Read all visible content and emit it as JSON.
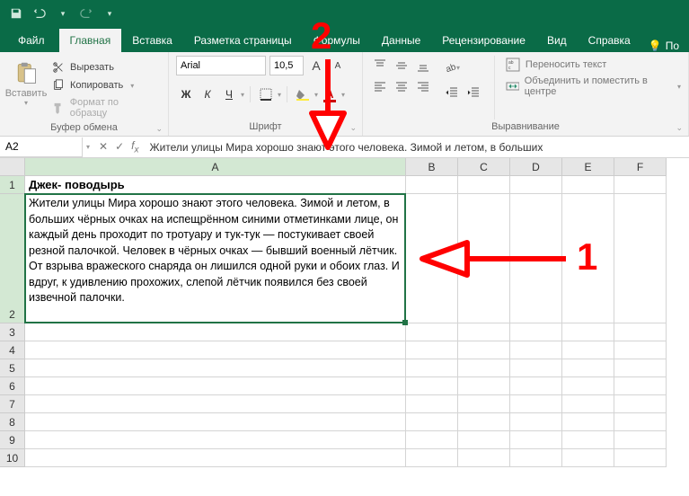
{
  "qat": {
    "save": "save-icon",
    "undo": "undo-icon",
    "redo": "redo-icon"
  },
  "tabs": {
    "file": "Файл",
    "list": [
      "Главная",
      "Вставка",
      "Разметка страницы",
      "Формулы",
      "Данные",
      "Рецензирование",
      "Вид",
      "Справка"
    ],
    "activeIndex": 0,
    "help_hint": "По"
  },
  "ribbon": {
    "clipboard": {
      "paste": "Вставить",
      "cut": "Вырезать",
      "copy": "Копировать",
      "format_painter": "Формат по образцу",
      "group_label": "Буфер обмена"
    },
    "font": {
      "name": "Arial",
      "size": "10,5",
      "grow": "A",
      "shrink": "A",
      "bold": "Ж",
      "italic": "К",
      "underline": "Ч",
      "group_label": "Шрифт"
    },
    "alignment": {
      "wrap": "Переносить текст",
      "merge": "Объединить и поместить в центре",
      "group_label": "Выравнивание"
    }
  },
  "formula_bar": {
    "name_box": "A2",
    "formula": "Жители улицы Мира хорошо знают этого человека. Зимой и летом, в больших"
  },
  "grid": {
    "columns": [
      "A",
      "B",
      "C",
      "D",
      "E",
      "F"
    ],
    "rows": [
      "1",
      "2",
      "3",
      "4",
      "5",
      "6",
      "7",
      "8",
      "9",
      "10"
    ],
    "a1": "Джек- поводырь",
    "a2": "Жители улицы Мира хорошо знают этого человека. Зимой и летом, в больших чёрных очках на испещрённом синими отметинками лице, он каждый день проходит по тротуару и тук-тук — постукивает своей резной палочкой. Человек в чёрных очках — бывший военный лётчик. От взрыва вражеского снаряда он лишился одной руки и обоих глаз. И вдруг, к удивлению прохожих, слепой лётчик появился без своей извечной палочки."
  },
  "annotations": {
    "n1": "1",
    "n2": "2"
  }
}
